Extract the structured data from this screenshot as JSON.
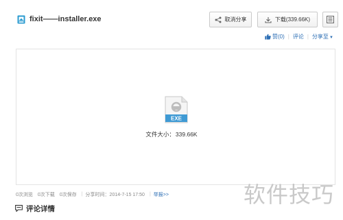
{
  "file": {
    "name": "fixit——installer.exe",
    "type_label": "EXE",
    "size_label": "文件大小：",
    "size_value": "339.66K"
  },
  "toolbar": {
    "share_label": "取消分享",
    "download_label": "下载(339.66K)"
  },
  "actions": {
    "like_label": "赞(0)",
    "comment_label": "评论",
    "share_to_label": "分享至"
  },
  "stats": {
    "views": "0次浏览",
    "downloads": "0次下载",
    "saves": "0次保存",
    "share_time": "分享时间：2014-7-15 17:50",
    "report": "举报>>"
  },
  "comments": {
    "title": "评论详情"
  },
  "watermark": "软件技巧",
  "colors": {
    "accent_blue": "#2d6fb5",
    "icon_teal": "#2b9bd0"
  },
  "icons": {
    "file_type": "app-file-icon",
    "share": "share-icon",
    "download": "download-icon",
    "qr": "qr-code-icon",
    "like": "thumbs-up-icon",
    "comments": "chat-icon"
  }
}
